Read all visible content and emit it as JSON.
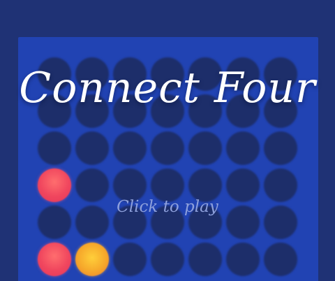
{
  "game": {
    "title": "Connect Four",
    "cta_label": "Click to play"
  },
  "board": {
    "columns": 7,
    "rows_visible": 6,
    "colors": {
      "background": "#1f3275",
      "board": "#2143b3",
      "empty_cell": "#1d2e6a",
      "red_disc": "#f0465e",
      "yellow_disc": "#f6a82b",
      "title_text": "#ffffff",
      "cta_text": "#8ea0dc"
    },
    "discs": [
      {
        "row": 3,
        "col": 0,
        "color": "red"
      },
      {
        "row": 5,
        "col": 0,
        "color": "red"
      },
      {
        "row": 5,
        "col": 1,
        "color": "yellow"
      }
    ]
  }
}
